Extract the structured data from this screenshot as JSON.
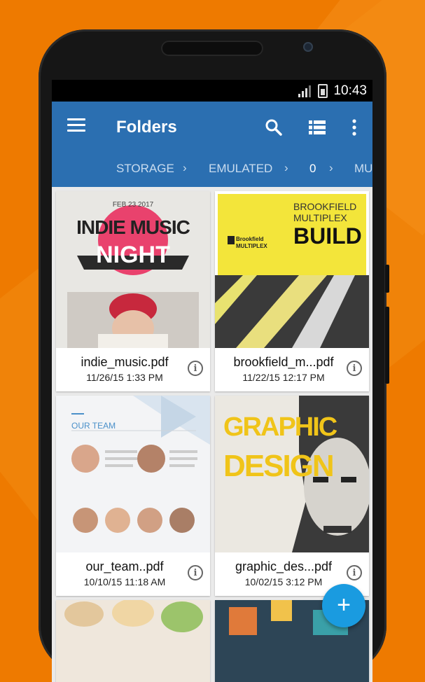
{
  "status_bar": {
    "time": "10:43"
  },
  "app_bar": {
    "title": "Folders",
    "icons": [
      "menu-icon",
      "search-icon",
      "list-view-icon",
      "more-vert-icon"
    ],
    "color": "#2b6fb1"
  },
  "breadcrumbs": [
    {
      "label": "STORAGE"
    },
    {
      "label": "EMULATED"
    },
    {
      "label": "0"
    },
    {
      "label": "MU"
    }
  ],
  "files": [
    {
      "name": "indie_music.pdf",
      "date": "11/26/15 1:33 PM",
      "thumb": {
        "line1": "INDIE MUSIC",
        "line2": "NIGHT",
        "kicker": "FEB 23 2017"
      }
    },
    {
      "name": "brookfield_m...pdf",
      "date": "11/22/15 12:17 PM",
      "thumb": {
        "line1": "BROOKFIELD",
        "line2": "MULTIPLEX",
        "line3": "BUILD",
        "brand": "Brookfield MULTIPLEX"
      }
    },
    {
      "name": "our_team..pdf",
      "date": "10/10/15 11:18 AM",
      "thumb": {
        "heading": "OUR TEAM"
      }
    },
    {
      "name": "graphic_des...pdf",
      "date": "10/02/15 3:12 PM",
      "thumb": {
        "line1": "GRAPHIC",
        "line2": "DESIGN"
      }
    }
  ],
  "fab": {
    "label": "+",
    "color": "#1a9be0"
  }
}
